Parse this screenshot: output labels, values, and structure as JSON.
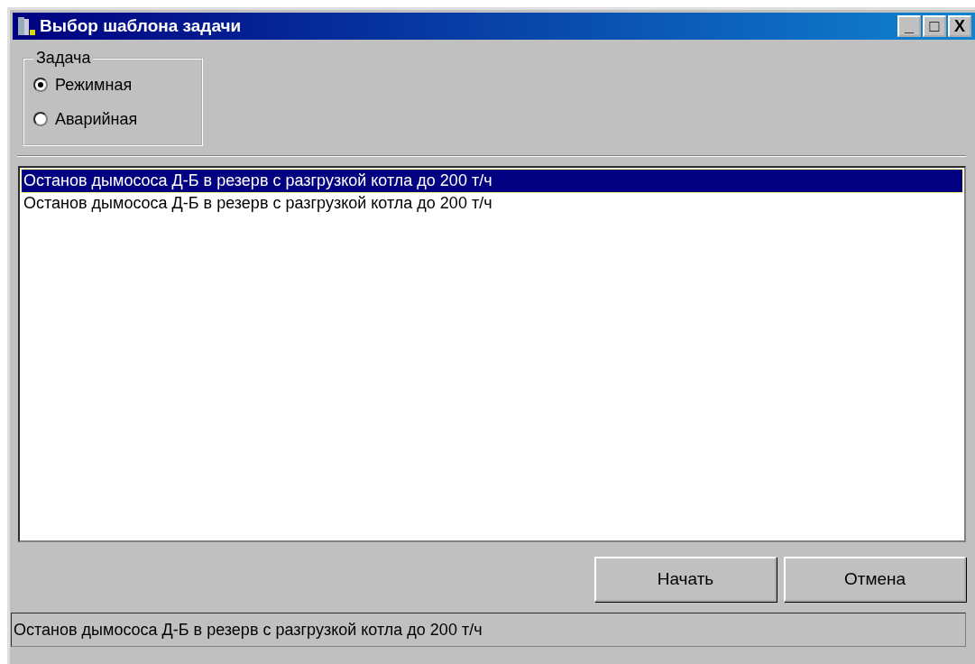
{
  "window": {
    "title": "Выбор шаблона задачи",
    "controls": [
      "_",
      "□",
      "X"
    ]
  },
  "task_group": {
    "title": "Задача",
    "options": [
      {
        "label": "Режимная",
        "selected": true
      },
      {
        "label": "Аварийная",
        "selected": false
      }
    ]
  },
  "templates": [
    {
      "label": "Останов дымососа Д-Б в резерв с разгрузкой котла до 200 т/ч",
      "selected": true
    },
    {
      "label": "Останов дымососа Д-Б в резерв с разгрузкой котла до 200 т/ч",
      "selected": false
    }
  ],
  "buttons": [
    "Начать",
    "Отмена"
  ],
  "status_bar": "Останов дымососа Д-Б в резерв с разгрузкой котла до 200 т/ч"
}
